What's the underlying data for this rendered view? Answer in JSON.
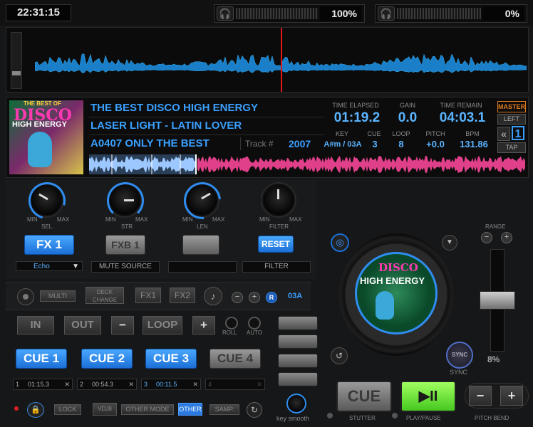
{
  "topbar": {
    "clock": "22:31:15",
    "left_volume": "100%",
    "right_volume": "0%",
    "left_headphone_color": "#28c04a",
    "right_headphone_color": "#e0332c"
  },
  "deck": {
    "album_art_text": {
      "line1": "THE BEST OF",
      "line2": "DISCO",
      "line3": "HIGH ENERGY"
    },
    "title": "THE BEST DISCO HIGH ENERGY",
    "artist": "LASER LIGHT - LATIN LOVER",
    "album": "A0407 ONLY THE BEST",
    "track_label": "Track #",
    "track_value": "2007",
    "time_elapsed_label": "TIME ELAPSED",
    "time_elapsed": "01:19.2",
    "gain_label": "GAIN",
    "gain": "0.0",
    "time_remain_label": "TIME REMAIN",
    "time_remain": "04:03.1",
    "key_label": "KEY",
    "key": "A#m / 03A",
    "cue_label": "CUE",
    "cue": "3",
    "loop_label": "LOOP",
    "loop": "8",
    "pitch_label": "PITCH",
    "pitch": "+0.0",
    "bpm_label": "BPM",
    "bpm": "131.86",
    "master_label": "MASTER",
    "left_label": "LEFT",
    "deck_number": "1",
    "tap_label": "TAP",
    "back_symbol": "«"
  },
  "effects": {
    "knobs": [
      {
        "name": "SEL.",
        "min": "MIN",
        "max": "MAX"
      },
      {
        "name": "STR",
        "min": "MIN",
        "max": "MAX"
      },
      {
        "name": "LEN",
        "min": "MIN",
        "max": "MAX"
      },
      {
        "name": "FILTER",
        "min": "MIN",
        "max": "MAX"
      }
    ],
    "fx1_label": "FX 1",
    "fxb1_label": "FXB 1",
    "reset_label": "RESET",
    "fx1_select": "Echo",
    "mute_source": "MUTE SOURCE",
    "filter_label": "FILTER"
  },
  "controls": {
    "multi": "MULTI",
    "deck_change": "DECK CHANGE",
    "fx1": "FX1",
    "fx2": "FX2",
    "minus": "−",
    "plus": "+",
    "r": "R",
    "key_value": "03A",
    "in": "IN",
    "out": "OUT",
    "loop": "LOOP",
    "roll": "ROLL",
    "auto": "AUTO",
    "cues": [
      "CUE 1",
      "CUE 2",
      "CUE 3",
      "CUE 4"
    ],
    "mem": [
      {
        "num": "1",
        "time": "01:15.3"
      },
      {
        "num": "2",
        "time": "00:54.3"
      },
      {
        "num": "3",
        "time": "00:11.5"
      },
      {
        "num": "4",
        "time": ""
      }
    ],
    "lock": "LOCK",
    "vdj": "VDJ8",
    "other_mode": "OTHER MODE",
    "other": "OTHER",
    "samp": "SAMP.",
    "key_smooth": "key smooth"
  },
  "transport": {
    "cue": "CUE",
    "play": "▶II",
    "stutter": "STUTTER",
    "play_pause": "PLAY/PAUSE",
    "pitch_bend": "PITCH BEND",
    "sync": "SYNC",
    "sync_label": "SYNC",
    "range": "RANGE",
    "pitch_range": "8%",
    "minus": "−",
    "plus": "+"
  },
  "platter": {
    "art_line1": "DISCO",
    "art_line2": "HIGH ENERGY"
  }
}
